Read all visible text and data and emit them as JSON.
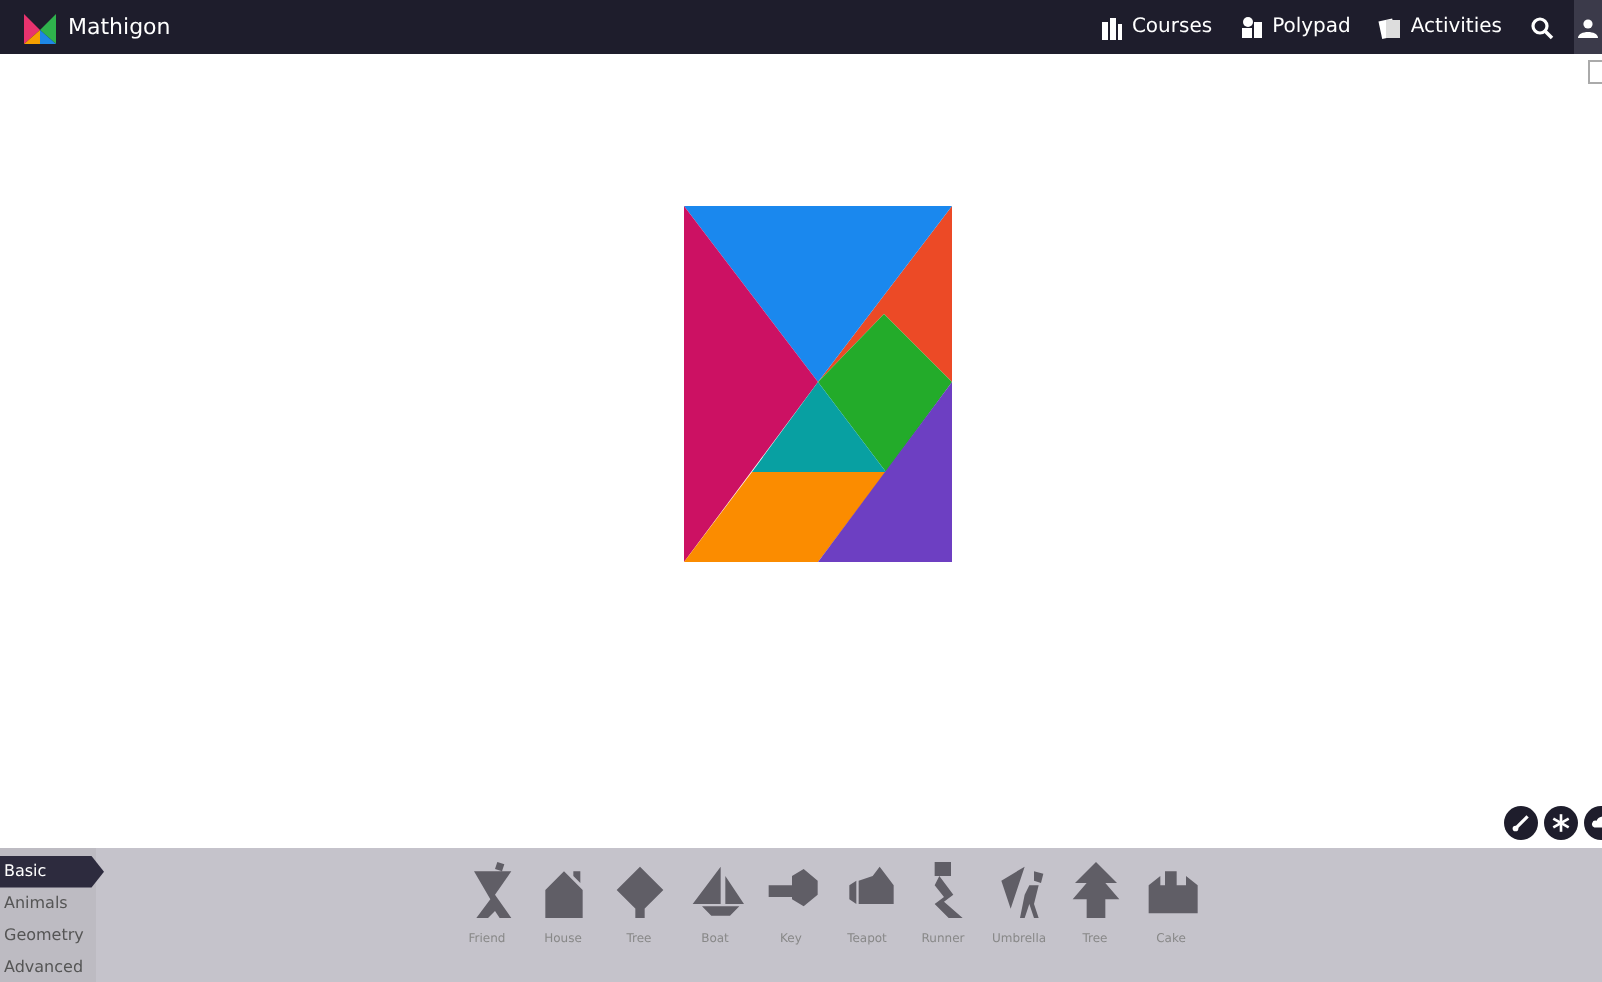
{
  "nav": {
    "brand": "Mathigon",
    "links": [
      {
        "label": "Courses"
      },
      {
        "label": "Polypad"
      },
      {
        "label": "Activities"
      }
    ]
  },
  "categories": [
    {
      "label": "Basic",
      "selected": true
    },
    {
      "label": "Animals",
      "selected": false
    },
    {
      "label": "Geometry",
      "selected": false
    },
    {
      "label": "Advanced",
      "selected": false
    }
  ],
  "puzzles": [
    {
      "label": "Friend"
    },
    {
      "label": "House"
    },
    {
      "label": "Tree"
    },
    {
      "label": "Boat"
    },
    {
      "label": "Key"
    },
    {
      "label": "Teapot"
    },
    {
      "label": "Runner"
    },
    {
      "label": "Umbrella"
    },
    {
      "label": "Tree"
    },
    {
      "label": "Cake"
    }
  ]
}
